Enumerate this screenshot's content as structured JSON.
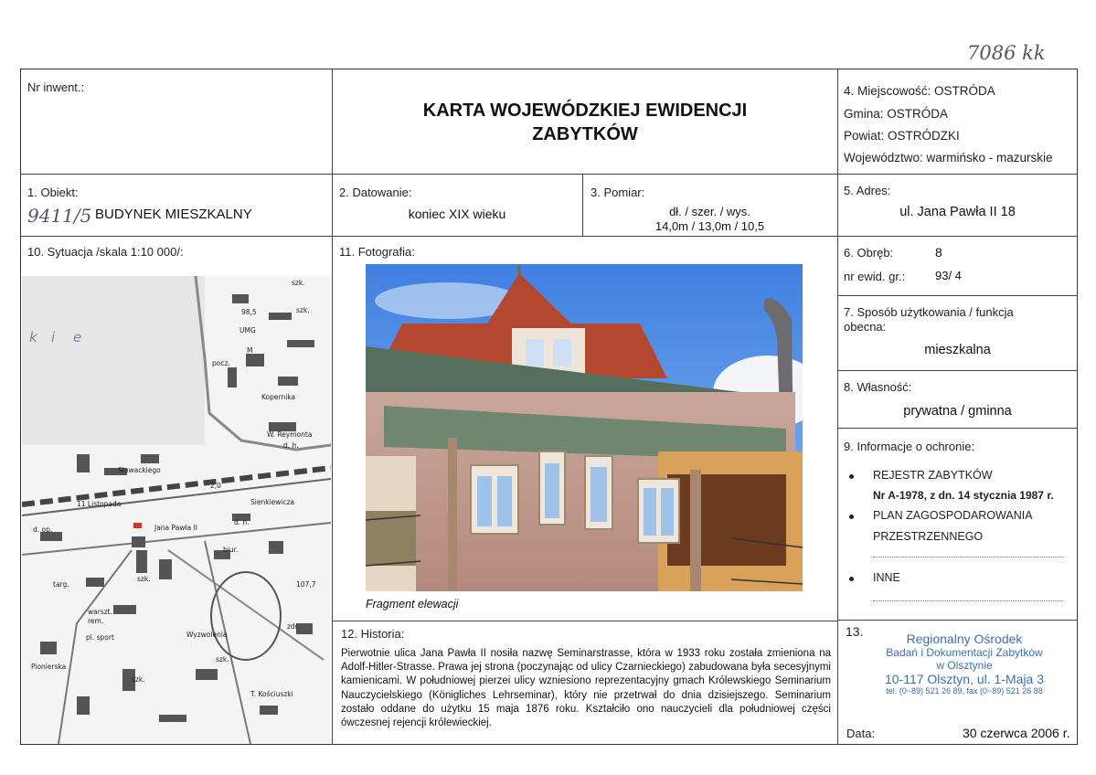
{
  "handwritten": {
    "top_number": "7086 kk",
    "object_code": "9411/5"
  },
  "header": {
    "inventory_label": "Nr inwent.:",
    "title_line1": "KARTA WOJEWÓDZKIEJ EWIDENCJI",
    "title_line2": "ZABYTKÓW",
    "location": {
      "place": "4. Miejscowość: OSTRÓDA",
      "commune": "Gmina: OSTRÓDA",
      "district": "Powiat: OSTRÓDZKI",
      "voivodeship": "Województwo:  warmińsko - mazurskie"
    }
  },
  "fields": {
    "object": {
      "label": "1. Obiekt:",
      "value": "BUDYNEK MIESZKALNY"
    },
    "dating": {
      "label": "2. Datowanie:",
      "value": "koniec XIX wieku"
    },
    "measure": {
      "label": "3. Pomiar:",
      "line1": "dł. / szer. / wys.",
      "line2": "14,0m / 13,0m / 10,5"
    },
    "address": {
      "label": "5. Adres:",
      "value": "ul. Jana Pawła II 18"
    },
    "situation": {
      "label": "10. Sytuacja /skala 1:10 000/:"
    },
    "photo": {
      "label": "11. Fotografia:",
      "caption": "Fragment elewacji"
    },
    "precinct": {
      "label": "6. Obręb:",
      "value": "8",
      "parcel_label": "nr ewid. gr.:",
      "parcel_value": "93/ 4"
    },
    "usage": {
      "label_line1": "7. Sposób użytkowania / funkcja",
      "label_line2": "obecna:",
      "value": "mieszkalna"
    },
    "ownership": {
      "label": "8. Własność:",
      "value": "prywatna / gminna"
    },
    "protection": {
      "label": "9. Informacje o ochronie:",
      "register": "REJESTR ZABYTKÓW",
      "register_no": "Nr A-1978, z dn. 14 stycznia 1987 r.",
      "plan_line1": "PLAN ZAGOSPODAROWANIA",
      "plan_line2": "PRZESTRZENNEGO",
      "other": "INNE"
    },
    "history": {
      "label": "12. Historia:",
      "text": "Pierwotnie ulica Jana Pawła II nosiła nazwę Seminarstrasse, która w 1933 roku została zmieniona na Adolf-Hitler-Strasse. Prawa jej strona (poczynając od ulicy Czarnieckiego) zabudowana była secesyjnymi kamienicami. W południowej pierzei ulicy wzniesiono reprezentacyjny gmach Królewskiego Seminarium Nauczycielskiego (Königliches Lehrseminar), który nie przetrwał do dnia dzisiejszego. Seminarium zostało oddane do użytku 15 maja 1876 roku. Kształciło ono nauczycieli dla południowej części ówczesnej rejencji królewieckiej."
    },
    "stamp_section": {
      "label": "13.",
      "line1": "Regionalny Ośrodek",
      "line2": "Badań i Dokumentacji Zabytków",
      "line3": "w Olsztynie",
      "line4": "10-117 Olsztyn, ul. 1-Maja 3",
      "line5": "tel. (0~89) 521 26 89, fax (0~89) 521 26 88",
      "date_label": "Data:",
      "date_value": "30 czerwca 2006 r."
    }
  },
  "map_labels": [
    "k",
    "i",
    "e",
    "szk.",
    "98,5",
    "UMG",
    "pocz.",
    "M",
    "szk.",
    "W. Reymonta",
    "d. h.",
    "Kopernika",
    "Sienkiewicza",
    "Słowackiego",
    "2,0",
    "d. op.",
    "11 Listopada",
    "Jana Pawła II",
    "szk.",
    "targ.",
    "biur.",
    "warszt.",
    "rem.",
    "pl. sport",
    "szk.",
    "szk.",
    "d. h.",
    "zdr.",
    "T. Kościuszki",
    "Wyzwolenia",
    "Pionierska",
    "107,7"
  ],
  "colors": {
    "stamp": "#3d6fb0",
    "map_marker": "#d6302a",
    "sky": "#5f9be8",
    "roof": "#b3472f"
  }
}
